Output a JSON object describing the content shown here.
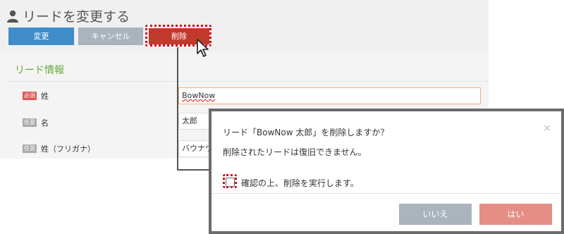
{
  "page": {
    "title": "リードを変更する",
    "buttons": {
      "change": "変更",
      "cancel": "キャンセル",
      "delete": "削除"
    },
    "section_title": "リード情報",
    "fields": [
      {
        "badge": "必須",
        "label": "姓",
        "value": "BowNow"
      },
      {
        "badge": "任意",
        "label": "名",
        "value": "太郎"
      },
      {
        "badge": "任意",
        "label": "姓（フリガナ）",
        "value": "バウナウ"
      }
    ]
  },
  "dialog": {
    "title": "リード「BowNow 太郎」を削除しますか？",
    "subtitle": "削除されたリードは復旧できません。",
    "close": "×",
    "confirm_label": "確認の上、削除を実行します。",
    "no_button": "いいえ",
    "yes_button": "はい"
  },
  "colors": {
    "primary": "#3f8cc9",
    "delete": "#c0392b",
    "section": "#6aa83a",
    "highlight": "#d0021b"
  }
}
